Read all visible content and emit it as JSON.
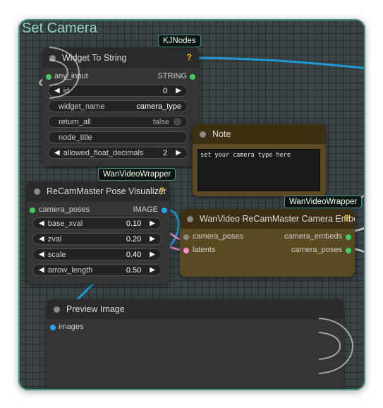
{
  "group": {
    "title": "Set Camera"
  },
  "badges": {
    "kjnodes": "KJNodes",
    "wanvideo_1": "WanVideoWrapper",
    "wanvideo_2": "WanVideoWrapper"
  },
  "colors": {
    "link_blue": "#1e9bd7",
    "link_pink": "#e98bd4",
    "socket_green": "#3ccf5e",
    "socket_blue": "#2aa3e6",
    "socket_pink": "#ff8fd9",
    "help_icon": "#f5c400"
  },
  "widget_to_string": {
    "title": "Widget To String",
    "help": "?",
    "input": "any_input",
    "output": "STRING",
    "widgets": {
      "id_label": "id",
      "id_value": "0",
      "widget_name_label": "widget_name",
      "widget_name_value": "camera_type",
      "return_all_label": "return_all",
      "return_all_value": "false",
      "node_title_label": "node_title",
      "allowed_float_decimals_label": "allowed_float_decimals",
      "allowed_float_decimals_value": "2"
    }
  },
  "note": {
    "title": "Note",
    "text": "set your camera type here"
  },
  "pose_visualizer": {
    "title": "ReCamMaster Pose Visualizer",
    "help": "?",
    "input": "camera_poses",
    "output": "IMAGE",
    "widgets": [
      {
        "label": "base_xval",
        "value": "0.10"
      },
      {
        "label": "zval",
        "value": "0.20"
      },
      {
        "label": "scale",
        "value": "0.40"
      },
      {
        "label": "arrow_length",
        "value": "0.50"
      }
    ]
  },
  "camera_embeds": {
    "title": "WanVideo ReCamMaster Camera Embeds",
    "help": "?",
    "inputs": [
      "camera_poses",
      "latents"
    ],
    "outputs": [
      "camera_embeds",
      "camera_poses"
    ]
  },
  "preview_image": {
    "title": "Preview Image",
    "input": "images"
  }
}
